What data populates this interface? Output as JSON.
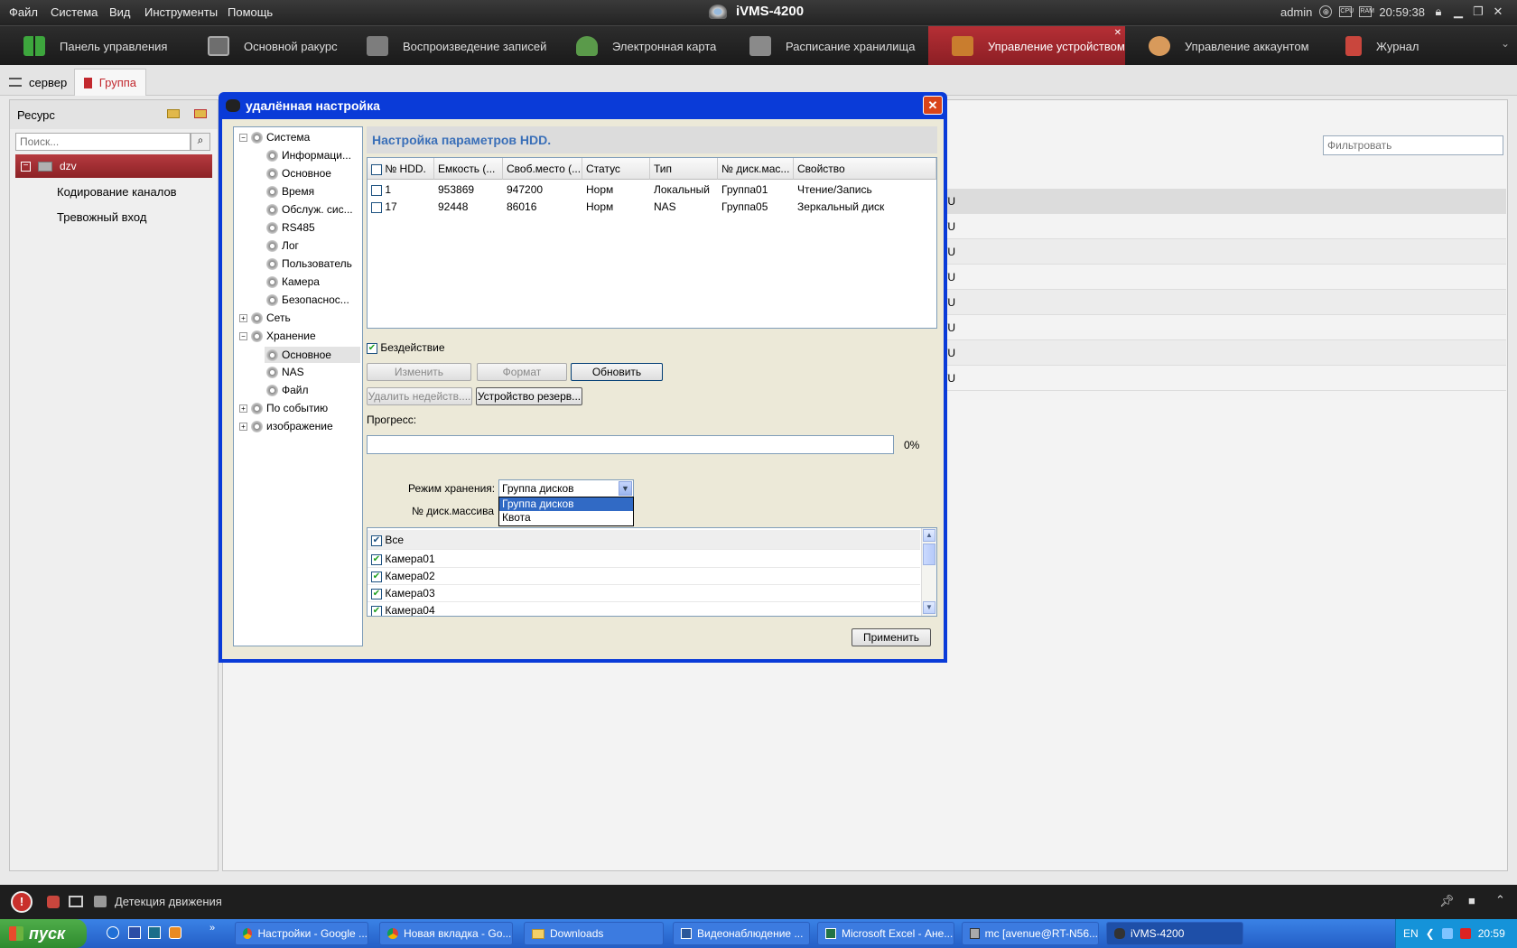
{
  "menubar": {
    "menus": [
      "Файл",
      "Система",
      "Вид",
      "Инструменты",
      "Помощь"
    ],
    "app_title": "iVMS-4200",
    "user": "admin",
    "time": "20:59:38",
    "cpu_label": "CPU",
    "ram_label": "RAM"
  },
  "toolbar": {
    "items": [
      {
        "label": "Панель управления",
        "icon": "dashboard-icon",
        "color": "#3da63d"
      },
      {
        "label": "Основной ракурс",
        "icon": "main-view-icon",
        "color": "#6e6e6e"
      },
      {
        "label": "Воспроизведение записей",
        "icon": "playback-icon",
        "color": "#7d7d7d"
      },
      {
        "label": "Электронная карта",
        "icon": "emap-icon",
        "color": "#5a9a4a"
      },
      {
        "label": "Расписание хранилища",
        "icon": "storage-schedule-icon",
        "color": "#8a8a8a"
      },
      {
        "label": "Управление устройством",
        "icon": "device-management-icon",
        "color": "#c97d2e"
      },
      {
        "label": "Управление аккаунтом",
        "icon": "account-icon",
        "color": "#d89a5b"
      },
      {
        "label": "Журнал",
        "icon": "log-icon",
        "color": "#c9463d"
      }
    ],
    "active_index": 5
  },
  "subtabs": [
    {
      "label": "сервер",
      "icon": "server-icon"
    },
    {
      "label": "Группа",
      "icon": "group-icon"
    }
  ],
  "left_panel": {
    "title": "Ресурс",
    "search_placeholder": "Поиск...",
    "node": "dzv",
    "items": [
      "Кодирование каналов",
      "Тревожный вход"
    ]
  },
  "main": {
    "filter_placeholder": "Фильтровать",
    "row_tail": "/U"
  },
  "dialog": {
    "title": "удалённая настройка",
    "tree": [
      {
        "label": "Система",
        "level": 0,
        "expander": "−"
      },
      {
        "label": "Информаци...",
        "level": 1
      },
      {
        "label": "Основное",
        "level": 1
      },
      {
        "label": "Время",
        "level": 1
      },
      {
        "label": "Обслуж. сис...",
        "level": 1
      },
      {
        "label": "RS485",
        "level": 1
      },
      {
        "label": "Лог",
        "level": 1
      },
      {
        "label": "Пользователь",
        "level": 1
      },
      {
        "label": "Камера",
        "level": 1
      },
      {
        "label": "Безопаснос...",
        "level": 1
      },
      {
        "label": "Сеть",
        "level": 0,
        "expander": "+"
      },
      {
        "label": "Хранение",
        "level": 0,
        "expander": "−"
      },
      {
        "label": "Основное",
        "level": 1,
        "selected": true
      },
      {
        "label": "NAS",
        "level": 1
      },
      {
        "label": "Файл",
        "level": 1
      },
      {
        "label": "По событию",
        "level": 0,
        "expander": "+"
      },
      {
        "label": "изображение",
        "level": 0,
        "expander": "+"
      }
    ],
    "section_title": "Настройка параметров HDD.",
    "table": {
      "columns": [
        "№ HDD.",
        "Емкость (...",
        "Своб.место (...",
        "Статус",
        "Тип",
        "№ диск.мас...",
        "Свойство"
      ],
      "rows": [
        [
          "1",
          "953869",
          "947200",
          "Норм",
          "Локальный",
          "Группа01",
          "Чтение/Запись"
        ],
        [
          "17",
          "92448",
          "86016",
          "Норм",
          "NAS",
          "Группа05",
          "Зеркальный диск"
        ]
      ]
    },
    "idle_label": "Бездействие",
    "idle_checked": true,
    "buttons": {
      "edit": "Изменить",
      "format": "Формат",
      "refresh": "Обновить",
      "delete_idle": "Удалить недейств....",
      "backup_device": "Устройство резерв...",
      "apply": "Применить"
    },
    "progress_label": "Прогресс:",
    "progress_value": "0%",
    "progress_fraction": 0,
    "storage_mode_label": "Режим хранения:",
    "storage_mode_value": "Группа дисков",
    "storage_mode_options": [
      "Группа дисков",
      "Квота"
    ],
    "array_label": "№ диск.массива",
    "cameras_all_label": "Все",
    "cameras": [
      "Камера01",
      "Камера02",
      "Камера03",
      "Камера04"
    ]
  },
  "statusbar": {
    "alarm_text": "Детекция движения"
  },
  "taskbar": {
    "start_label": "пуск",
    "tasks": [
      {
        "label": "Настройки - Google ...",
        "icon": "chrome-icon"
      },
      {
        "label": "Новая вкладка - Go...",
        "icon": "chrome-icon"
      },
      {
        "label": "Downloads",
        "icon": "folder-icon"
      },
      {
        "label": "Видеонаблюдение ...",
        "icon": "word-icon"
      },
      {
        "label": "Microsoft Excel - Ане...",
        "icon": "excel-icon"
      },
      {
        "label": "mc [avenue@RT-N56...",
        "icon": "putty-icon"
      },
      {
        "label": "iVMS-4200",
        "icon": "ivms-icon",
        "active": true
      }
    ],
    "lang": "EN",
    "clock": "20:59"
  }
}
